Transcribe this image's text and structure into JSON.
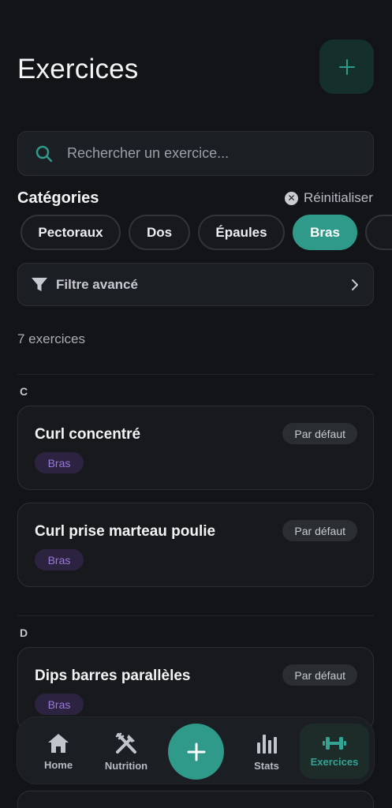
{
  "header": {
    "title": "Exercices"
  },
  "search": {
    "placeholder": "Rechercher un exercice..."
  },
  "categories": {
    "title": "Catégories",
    "reset_label": "Réinitialiser",
    "chips": [
      {
        "label": "Pectoraux",
        "active": false
      },
      {
        "label": "Dos",
        "active": false
      },
      {
        "label": "Épaules",
        "active": false
      },
      {
        "label": "Bras",
        "active": true
      },
      {
        "label": "",
        "active": false
      }
    ]
  },
  "filter": {
    "label": "Filtre avancé"
  },
  "count": "7 exercices",
  "sections": [
    {
      "letter": "C",
      "items": [
        {
          "name": "Curl concentré",
          "badge": "Par défaut",
          "tag": "Bras"
        },
        {
          "name": "Curl prise marteau poulie",
          "badge": "Par défaut",
          "tag": "Bras"
        }
      ]
    },
    {
      "letter": "D",
      "items": [
        {
          "name": "Dips barres parallèles",
          "badge": "Par défaut",
          "tag": "Bras"
        }
      ]
    }
  ],
  "nav": {
    "home": "Home",
    "nutrition": "Nutrition",
    "stats": "Stats",
    "exercices": "Exercices"
  },
  "colors": {
    "accent": "#2f9a8a",
    "background": "#121417",
    "tag_text": "#9a7ad9"
  }
}
